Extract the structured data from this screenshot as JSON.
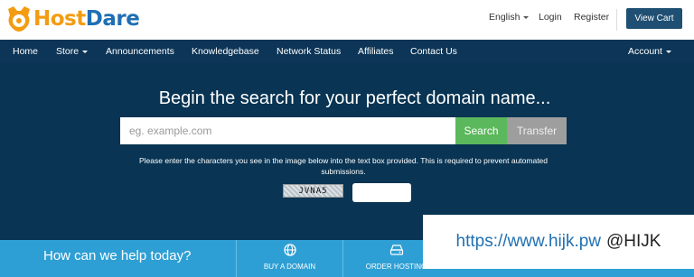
{
  "brand": {
    "host": "Host",
    "dare": "Dare"
  },
  "top_links": {
    "language": "English",
    "login": "Login",
    "register": "Register",
    "view_cart": "View Cart"
  },
  "nav": {
    "home": "Home",
    "store": "Store",
    "announcements": "Announcements",
    "knowledgebase": "Knowledgebase",
    "network_status": "Network Status",
    "affiliates": "Affiliates",
    "contact_us": "Contact Us",
    "account": "Account"
  },
  "hero": {
    "headline": "Begin the search for your perfect domain name...",
    "search_placeholder": "eg. example.com",
    "search_label": "Search",
    "transfer_label": "Transfer",
    "captcha_instructions": "Please enter the characters you see in the image below into the text box provided. This is required to prevent automated submissions.",
    "captcha_code": "JVNA5"
  },
  "bottom": {
    "help_text": "How can we help today?",
    "tiles": [
      {
        "label": "BUY A DOMAIN"
      },
      {
        "label": "ORDER HOSTING"
      }
    ]
  },
  "watermark": {
    "url": "https://www.hijk.pw",
    "handle": "@HIJK"
  },
  "colors": {
    "nav_bg": "#0c3557",
    "hero_bg": "#093453",
    "search_green": "#5cb85c",
    "transfer_gray": "#9e9e9e",
    "bottom_blue": "#2e9fd4",
    "brand_orange": "#f39c12",
    "brand_blue": "#1f6fb2"
  }
}
